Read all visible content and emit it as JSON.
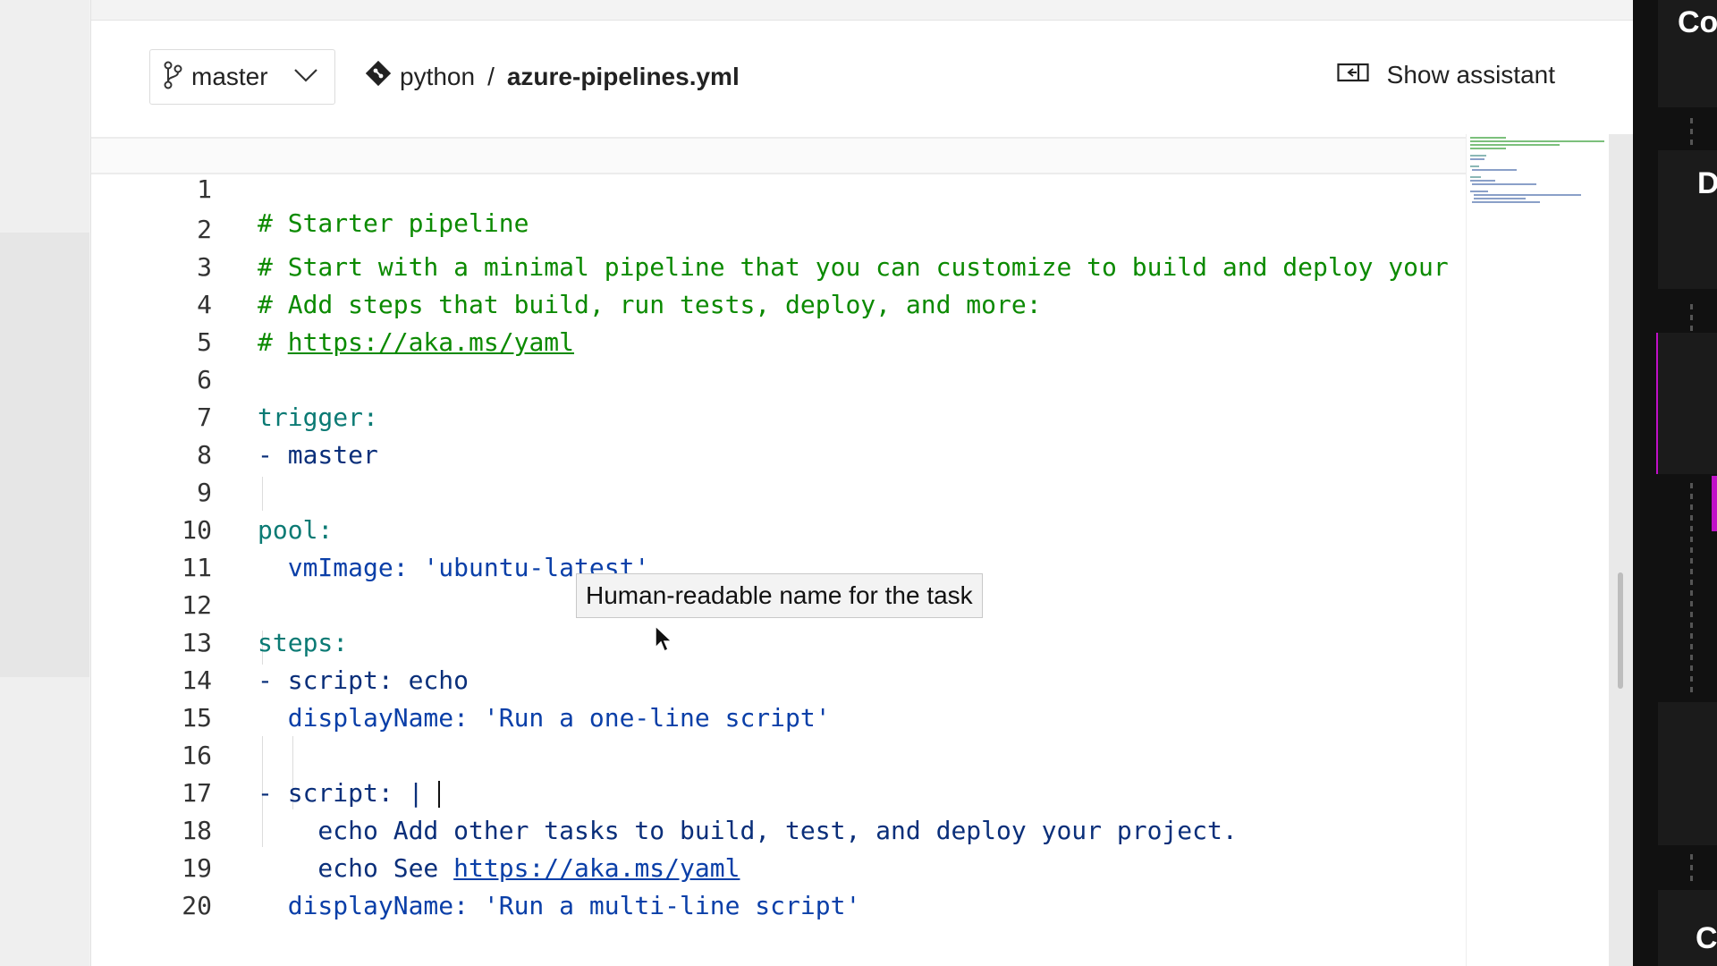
{
  "header": {
    "branch": "master",
    "repo": "python",
    "separator": "/",
    "file": "azure-pipelines.yml",
    "assistant_label": "Show assistant"
  },
  "editor": {
    "lines": [
      "# Starter pipeline",
      "# Start with a minimal pipeline that you can customize to build and deploy your",
      "# Add steps that build, run tests, deploy, and more:",
      "# https://aka.ms/yaml",
      "",
      "trigger:",
      "- master",
      "",
      "pool:",
      "  vmImage: 'ubuntu-latest'",
      "",
      "steps:",
      "- script: echo",
      "  displayName: 'Run a one-line script'",
      "",
      "- script: |",
      "    echo Add other tasks to build, test, and deploy your project.",
      "    echo See https://aka.ms/yaml",
      "  displayName: 'Run a multi-line script'",
      ""
    ],
    "line_numbers": [
      "1",
      "2",
      "3",
      "4",
      "5",
      "6",
      "7",
      "8",
      "9",
      "10",
      "11",
      "12",
      "13",
      "14",
      "15",
      "16",
      "17",
      "18",
      "19",
      "20"
    ]
  },
  "tooltip": {
    "text": "Human-readable name for the task"
  },
  "right_panel": {
    "labels": [
      "Co",
      "D",
      "C"
    ]
  },
  "colors": {
    "comment": "#0b8a00",
    "key": "#0b7a74",
    "string": "#0a3fa8",
    "accent_magenta": "#c010c8"
  }
}
